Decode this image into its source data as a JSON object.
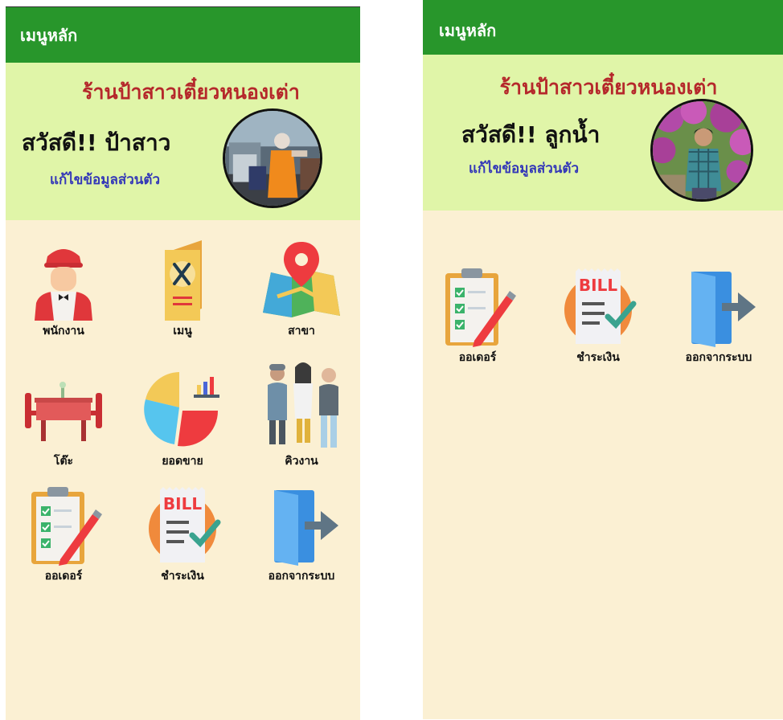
{
  "left_screen": {
    "appbar_title": "เมนูหลัก",
    "shop_name": "ร้านป้าสาวเตี๋ยวหนองเต่า",
    "greeting": "สวัสดี!! ป้าสาว",
    "edit_profile": "แก้ไขข้อมูลส่วนตัว",
    "menu": [
      {
        "label": "พนักงาน",
        "icon": "employee-icon"
      },
      {
        "label": "เมนู",
        "icon": "food-menu-icon"
      },
      {
        "label": "สาขา",
        "icon": "branch-map-icon"
      },
      {
        "label": "โต๊ะ",
        "icon": "table-icon"
      },
      {
        "label": "ยอดขาย",
        "icon": "sales-chart-icon"
      },
      {
        "label": "คิวงาน",
        "icon": "queue-icon"
      },
      {
        "label": "ออเดอร์",
        "icon": "order-clipboard-icon"
      },
      {
        "label": "ชำระเงิน",
        "icon": "bill-icon"
      },
      {
        "label": "ออกจากระบบ",
        "icon": "logout-icon"
      }
    ]
  },
  "right_screen": {
    "appbar_title": "เมนูหลัก",
    "shop_name": "ร้านป้าสาวเตี๋ยวหนองเต่า",
    "greeting": "สวัสดี!! ลูกน้ำ",
    "edit_profile": "แก้ไขข้อมูลส่วนตัว",
    "menu": [
      {
        "label": "ออเดอร์",
        "icon": "order-clipboard-icon"
      },
      {
        "label": "ชำระเงิน",
        "icon": "bill-icon"
      },
      {
        "label": "ออกจากระบบ",
        "icon": "logout-icon"
      }
    ]
  },
  "bill_text": "BILL",
  "colors": {
    "appbar": "#28962b",
    "profile_bg": "#e0f5a8",
    "body_bg": "#fbf0d3",
    "shop_name": "#b5282b",
    "edit_link": "#3438b8"
  }
}
